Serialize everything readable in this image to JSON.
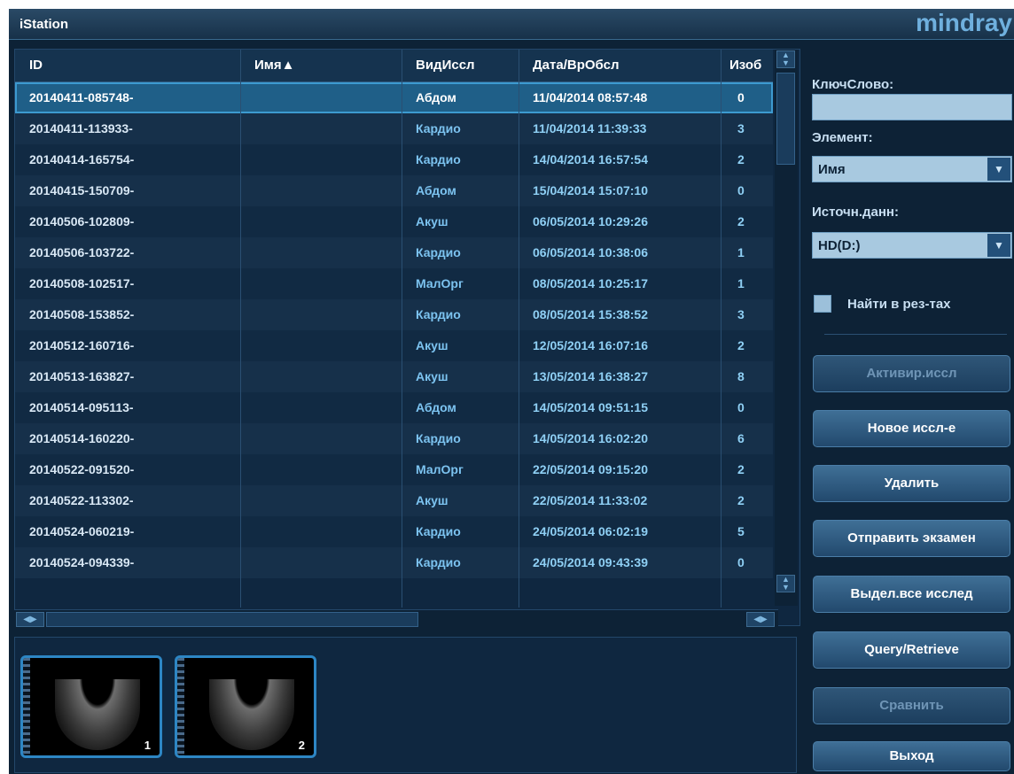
{
  "window": {
    "title": "iStation",
    "brand": "mindray"
  },
  "table": {
    "columns": [
      "ID",
      "Имя▲",
      "ВидИссл",
      "Дата/ВрОбсл",
      "Изоб"
    ],
    "rows": [
      {
        "id": "20140411-085748-",
        "name": "",
        "type": "Абдом",
        "date": "11/04/2014 08:57:48",
        "images": "0"
      },
      {
        "id": "20140411-113933-",
        "name": "",
        "type": "Кардио",
        "date": "11/04/2014 11:39:33",
        "images": "3"
      },
      {
        "id": "20140414-165754-",
        "name": "",
        "type": "Кардио",
        "date": "14/04/2014 16:57:54",
        "images": "2"
      },
      {
        "id": "20140415-150709-",
        "name": "",
        "type": "Абдом",
        "date": "15/04/2014 15:07:10",
        "images": "0"
      },
      {
        "id": "20140506-102809-",
        "name": "",
        "type": "Акуш",
        "date": "06/05/2014 10:29:26",
        "images": "2"
      },
      {
        "id": "20140506-103722-",
        "name": "",
        "type": "Кардио",
        "date": "06/05/2014 10:38:06",
        "images": "1"
      },
      {
        "id": "20140508-102517-",
        "name": "",
        "type": "МалОрг",
        "date": "08/05/2014 10:25:17",
        "images": "1"
      },
      {
        "id": "20140508-153852-",
        "name": "",
        "type": "Кардио",
        "date": "08/05/2014 15:38:52",
        "images": "3"
      },
      {
        "id": "20140512-160716-",
        "name": "",
        "type": "Акуш",
        "date": "12/05/2014 16:07:16",
        "images": "2"
      },
      {
        "id": "20140513-163827-",
        "name": "",
        "type": "Акуш",
        "date": "13/05/2014 16:38:27",
        "images": "8"
      },
      {
        "id": "20140514-095113-",
        "name": "",
        "type": "Абдом",
        "date": "14/05/2014 09:51:15",
        "images": "0"
      },
      {
        "id": "20140514-160220-",
        "name": "",
        "type": "Кардио",
        "date": "14/05/2014 16:02:20",
        "images": "6"
      },
      {
        "id": "20140522-091520-",
        "name": "",
        "type": "МалОрг",
        "date": "22/05/2014 09:15:20",
        "images": "2"
      },
      {
        "id": "20140522-113302-",
        "name": "",
        "type": "Акуш",
        "date": "22/05/2014 11:33:02",
        "images": "2"
      },
      {
        "id": "20140524-060219-",
        "name": "",
        "type": "Кардио",
        "date": "24/05/2014 06:02:19",
        "images": "5"
      },
      {
        "id": "20140524-094339-",
        "name": "",
        "type": "Кардио",
        "date": "24/05/2014 09:43:39",
        "images": "0"
      }
    ],
    "selected_index": 0
  },
  "thumbnails": [
    {
      "number": "1"
    },
    {
      "number": "2"
    }
  ],
  "side": {
    "keyword_label": "КлючСлово:",
    "keyword_value": "",
    "element_label": "Элемент:",
    "element_value": "Имя",
    "source_label": "Источн.данн:",
    "source_value": "HD(D:)",
    "search_in_results_label": "Найти в рез-тах",
    "search_in_results_checked": false,
    "buttons": {
      "activate": "Активир.иссл",
      "new_exam": "Новое иссл-е",
      "delete": "Удалить",
      "send_exam": "Отправить экзамен",
      "select_all": "Выдел.все исслед",
      "query_retrieve": "Query/Retrieve",
      "compare": "Сравнить",
      "exit": "Выход"
    },
    "disabled_buttons": [
      "activate",
      "compare"
    ]
  },
  "icons": {
    "scroll_up": "triangle-up-icon",
    "scroll_down": "triangle-down-icon",
    "scroll_left": "triangle-left-icon",
    "scroll_right": "triangle-right-icon",
    "dropdown": "chevron-down-icon"
  },
  "colors": {
    "accent": "#2d86c4",
    "selected_row": "#1f5f88",
    "background": "#0d2236"
  }
}
